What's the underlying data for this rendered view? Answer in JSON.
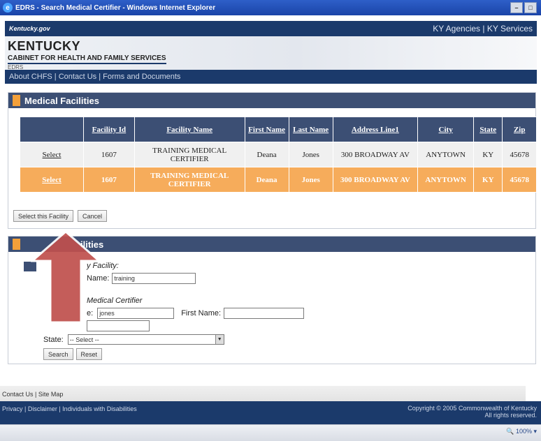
{
  "window": {
    "title": "EDRS - Search Medical Certifier - Windows Internet Explorer",
    "ie_icon": "e"
  },
  "header": {
    "logo": "Kentucky.gov",
    "agencies_link": "KY Agencies",
    "separator": "|",
    "services_link": "KY Services",
    "state": "KENTUCKY",
    "cabinet": "CABINET FOR HEALTH AND FAMILY SERVICES",
    "app": "EDRS",
    "nav": {
      "about": "About CHFS",
      "contact": "Contact Us",
      "forms": "Forms and Documents",
      "sep": " | "
    }
  },
  "facilities_panel": {
    "title": "Medical Facilities",
    "columns": [
      "",
      "Facility Id",
      "Facility Name",
      "First Name",
      "Last Name",
      "Address Line1",
      "City",
      "State",
      "Zip"
    ],
    "rows": [
      {
        "select": "Select",
        "id": "1607",
        "name": "TRAINING MEDICAL CERTIFIER",
        "first": "Deana",
        "last": "Jones",
        "address": "300 BROADWAY AV",
        "city": "ANYTOWN",
        "state": "KY",
        "zip": "45678",
        "selected": false
      },
      {
        "select": "Select",
        "id": "1607",
        "name": "TRAINING MEDICAL CERTIFIER",
        "first": "Deana",
        "last": "Jones",
        "address": "300 BROADWAY AV",
        "city": "ANYTOWN",
        "state": "KY",
        "zip": "45678",
        "selected": true
      }
    ],
    "select_button": "Select this Facility",
    "cancel_button": "Cancel"
  },
  "search_panel": {
    "title_visible": "ilities",
    "by_facility_label": "y Facility:",
    "name_label": "Name:",
    "name_value": "training",
    "medical_certifier_label": "Medical Certifier",
    "last_name_label": "e:",
    "last_name_value": "jones",
    "first_name_label": "First Name:",
    "first_name_value": "",
    "state_label": "State:",
    "state_value": "-- Select --",
    "search_button": "Search",
    "reset_button": "Reset"
  },
  "footer": {
    "links": "Contact Us | Site Map",
    "policies": "Privacy | Disclaimer | Individuals with Disabilities",
    "copyright": "Copyright © 2005 Commonwealth of Kentucky",
    "rights": "All rights reserved."
  },
  "status": {
    "zoom": "100%"
  },
  "colors": {
    "header_navy": "#1b3a6b",
    "panel_head": "#3c4f74",
    "accent_orange": "#f3a03a",
    "selected_row": "#f6ac5b",
    "arrow_red": "#c0504d"
  },
  "icons": {
    "titlebar": "ie-icon",
    "window_min": "minimize-icon",
    "window_close": "close-icon",
    "overlay": "up-arrow-icon",
    "zoom": "zoom-icon"
  }
}
